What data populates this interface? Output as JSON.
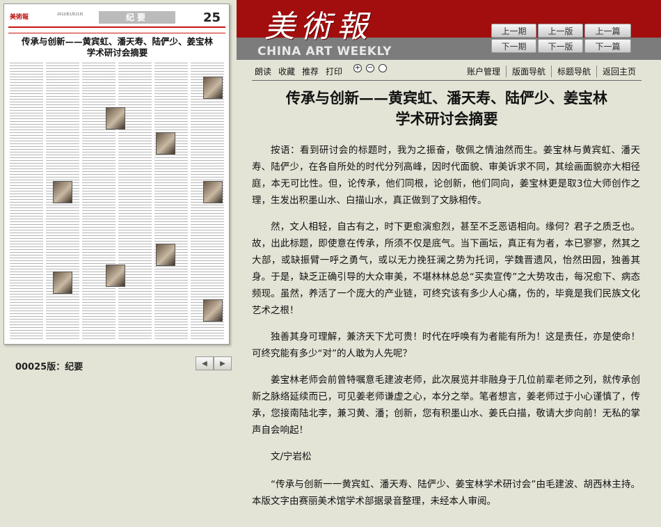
{
  "thumbnail": {
    "logo_text": "美術報",
    "date_text": "2012年1月21日",
    "section_label": "纪要",
    "page_number": "25",
    "title_line1": "传承与创新——黄宾虹、潘天寿、陆俨少、姜宝林",
    "title_line2": "学术研讨会摘要"
  },
  "page_label": "00025版：纪要",
  "pager": {
    "prev_icon": "◀",
    "next_icon": "▶"
  },
  "masthead": {
    "logo": "美術報",
    "english": "CHINA ART WEEKLY"
  },
  "nav": {
    "prev_issue": "上一期",
    "prev_page": "上一版",
    "prev_article": "上一篇",
    "next_issue": "下一期",
    "next_page": "下一版",
    "next_article": "下一篇"
  },
  "toolbar": {
    "read": "朗读",
    "favorite": "收藏",
    "recommend": "推荐",
    "print": "打印",
    "zoom_in": "+",
    "zoom_out": "−",
    "zoom_reset": "",
    "account": "账户管理",
    "layout_nav": "版面导航",
    "title_nav": "标题导航",
    "home": "返回主页"
  },
  "article": {
    "headline_line1": "传承与创新——黄宾虹、潘天寿、陆俨少、姜宝林",
    "headline_line2": "学术研讨会摘要",
    "paragraphs": [
      "按语：看到研讨会的标题时，我为之振奋，敬佩之情油然而生。姜宝林与黄宾虹、潘天寿、陆俨少，在各自所处的时代分列高峰，因时代面貌、审美诉求不同，其绘画面貌亦大相径庭，本无可比性。但，论传承，他们同根，论创新，他们同向，姜宝林更是取3位大师创作之理，生发出积墨山水、白描山水，真正做到了文脉相传。",
      "然，文人相轻，自古有之，时下更愈演愈烈，甚至不乏恶语相向。缘何？君子之质乏也。故，出此标题，即使意在传承，所须不仅是底气。当下画坛，真正有为者，本已寥寥，然其之大部，或缺振臂一呼之勇气，或以无力挽狂澜之势为托词，学魏晋遗风，怡然田园，独善其身。于是，缺乏正确引导的大众审美，不堪林林总总“买卖宣传”之大势攻击，每况愈下、病态频现。虽然，养活了一个庞大的产业链，可终究该有多少人心痛，伤的，毕竟是我们民族文化艺术之根！",
      "独善其身可理解，兼济天下尤可贵！时代在呼唤有为者能有所为！这是责任，亦是使命！可终究能有多少“对”的人敢为人先呢？",
      "姜宝林老师会前曾特嘱意毛建波老师，此次展览并非融身于几位前辈老师之列，就传承创新之脉络延续而已，可见姜老师谦虚之心，本分之举。笔者想言，姜老师过于小心谨慎了，传承，您接南陆北李，兼习黄、潘；创新，您有积墨山水、姜氏白描，敬请大步向前！无私的掌声自会响起！",
      "文/宁岩松",
      "“传承与创新一一黄宾虹、潘天寿、陆俨少、姜宝林学术研讨会”由毛建波、胡西林主持。本版文字由赛丽美术馆学术部据录音整理，未经本人审阅。"
    ]
  }
}
